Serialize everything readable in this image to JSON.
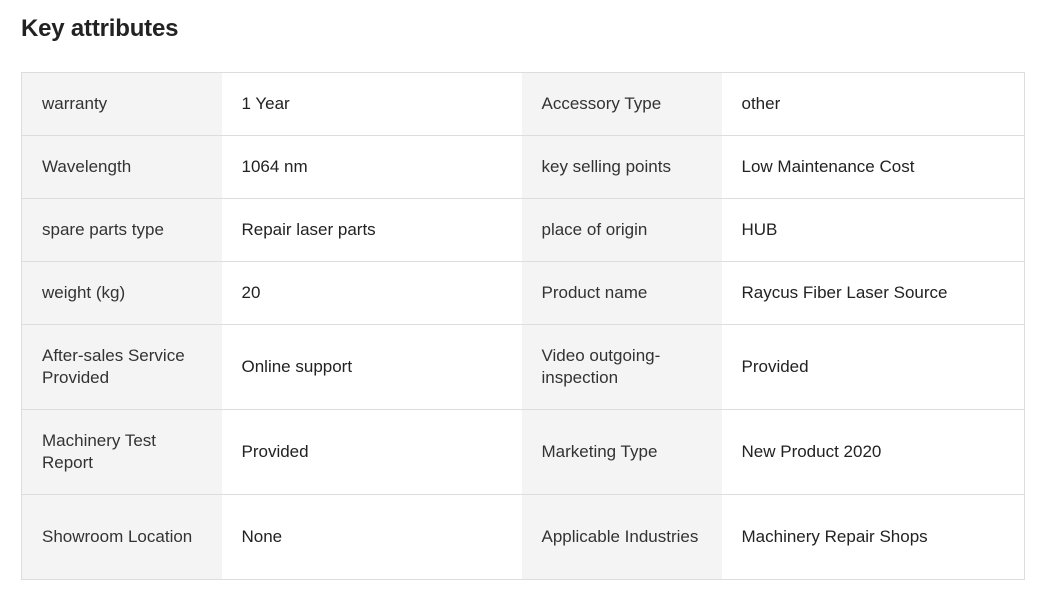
{
  "section": {
    "title": "Key attributes"
  },
  "attributes": [
    {
      "left_key": "warranty",
      "left_value": "1 Year",
      "right_key": "Accessory Type",
      "right_value": "other"
    },
    {
      "left_key": "Wavelength",
      "left_value": "1064 nm",
      "right_key": "key selling points",
      "right_value": "Low Maintenance Cost"
    },
    {
      "left_key": "spare parts type",
      "left_value": "Repair laser parts",
      "right_key": "place of origin",
      "right_value": "HUB"
    },
    {
      "left_key": "weight (kg)",
      "left_value": "20",
      "right_key": "Product name",
      "right_value": "Raycus Fiber Laser Source"
    },
    {
      "left_key": "After-sales Service Provided",
      "left_value": "Online support",
      "right_key": "Video outgoing-inspection",
      "right_value": "Provided"
    },
    {
      "left_key": "Machinery Test Report",
      "left_value": "Provided",
      "right_key": "Marketing Type",
      "right_value": "New Product 2020"
    },
    {
      "left_key": "Showroom Location",
      "left_value": "None",
      "right_key": "Applicable Industries",
      "right_value": "Machinery Repair Shops"
    }
  ],
  "colors": {
    "key_background": "#f4f4f4",
    "value_background": "#ffffff",
    "border": "#dddddd",
    "text": "#222222"
  }
}
